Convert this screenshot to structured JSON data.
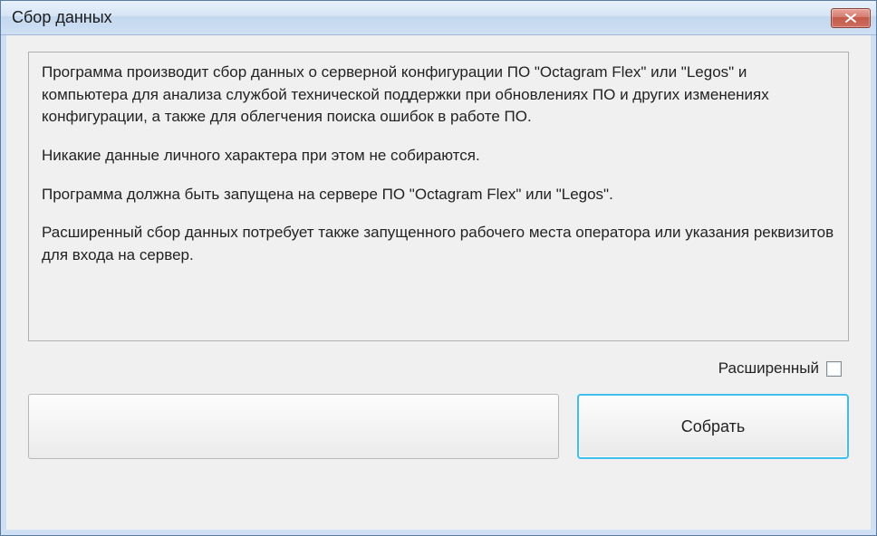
{
  "window": {
    "title": "Сбор данных"
  },
  "description": {
    "p1": "Программа производит сбор данных о серверной конфигурации ПО \"Octagram Flex\" или \"Legos\" и компьютера для анализа службой технической поддержки при обновлениях ПО и других изменениях конфигурации, а также для облегчения поиска ошибок в работе ПО.",
    "p2": "Никакие данные личного характера при этом не собираются.",
    "p3": "Программа должна быть запущена на сервере ПО \"Octagram Flex\" или \"Legos\".",
    "p4": "Расширенный сбор данных потребует также запущенного рабочего места оператора или указания реквизитов для входа на сервер."
  },
  "extended": {
    "label": "Расширенный",
    "checked": false
  },
  "buttons": {
    "collect": "Собрать"
  }
}
